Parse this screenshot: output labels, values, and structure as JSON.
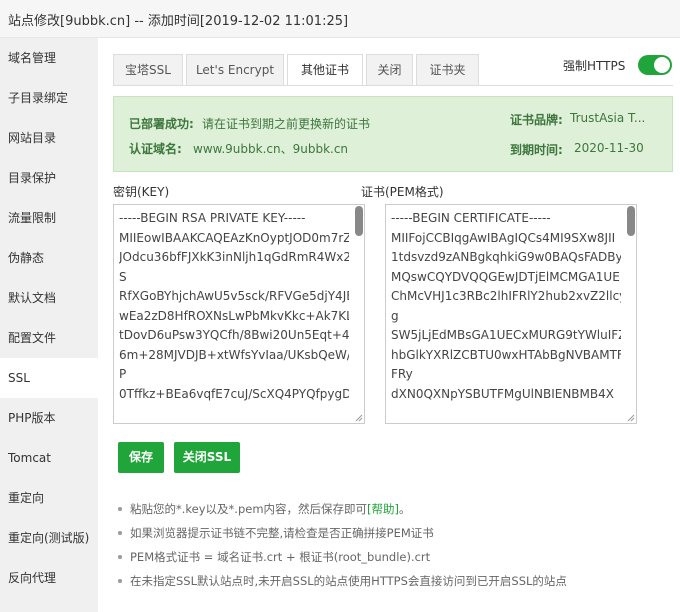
{
  "window": {
    "title": "站点修改[9ubbk.cn] -- 添加时间[2019-12-02 11:01:25]"
  },
  "sidebar": {
    "items": [
      {
        "label": "域名管理"
      },
      {
        "label": "子目录绑定"
      },
      {
        "label": "网站目录"
      },
      {
        "label": "目录保护"
      },
      {
        "label": "流量限制"
      },
      {
        "label": "伪静态"
      },
      {
        "label": "默认文档"
      },
      {
        "label": "配置文件"
      },
      {
        "label": "SSL"
      },
      {
        "label": "PHP版本"
      },
      {
        "label": "Tomcat"
      },
      {
        "label": "重定向"
      },
      {
        "label": "重定向(测试版)"
      },
      {
        "label": "反向代理"
      }
    ],
    "active": "SSL"
  },
  "tabs": [
    {
      "label": "宝塔SSL"
    },
    {
      "label": "Let's Encrypt"
    },
    {
      "label": "其他证书"
    },
    {
      "label": "关闭"
    },
    {
      "label": "证书夹"
    }
  ],
  "active_tab": "其他证书",
  "force_https": {
    "label": "强制HTTPS",
    "enabled": true
  },
  "status": {
    "deployed_key": "已部署成功:",
    "deployed_value": "请在证书到期之前更换新的证书",
    "domain_key": "认证域名:",
    "domain_value": "www.9ubbk.cn、9ubbk.cn",
    "brand_key": "证书品牌:",
    "brand_value": "TrustAsia T...",
    "expire_key": "到期时间:",
    "expire_value": "2020-11-30"
  },
  "key_field": {
    "label": "密钥(KEY)",
    "value": "-----BEGIN RSA PRIVATE KEY-----\nMIIEowIBAAKCAQEAzKnOyptJOD0m7rZ\nJOdcu36bfFJXkK3inNljh1qGdRmR4Wx2\nS\nRfXGoBYhjchAwU5v5sck/RFVGe5djY4JE\nwEa2zD8HfROXNsLwPbMkvKkc+Ak7KLJ\ntDovD6uPsw3YQCfh/8Bwi20Un5Eqt+4g\n6m+28MJVDJB+xtWfsYvIaa/UKsbQeW/\nP\n0Tffkz+BEa6vqfE7cuJ/ScXQ4PYQfpygDs"
  },
  "cert_field": {
    "label": "证书(PEM格式)",
    "value": "-----BEGIN CERTIFICATE-----\nMIIFojCCBIqgAwIBAgIQCs4MI9SXw8JII\n1tdsvzd9zANBgkqhkiG9w0BAQsFADBy\nMQswCQYDVQQGEwJDTjElMCMGA1UE\nChMcVHJ1c3RBc2lhIFRlY2hub2xvZ2llcyw\ng\nSW5jLjEdMBsGA1UECxMURG9tYWluIFZ\nhbGlkYXRlZCBTU0wxHTAbBgNVBAMTF\nFRy\ndXN0QXNpYSBUTFMgUlNBIENBMB4X"
  },
  "buttons": {
    "save": "保存",
    "close_ssl": "关闭SSL"
  },
  "tips": [
    {
      "text": "粘贴您的*.key以及*.pem内容，然后保存即可",
      "help": "[帮助]",
      "tail": "。"
    },
    {
      "text": "如果浏览器提示证书链不完整,请检查是否正确拼接PEM证书"
    },
    {
      "text": "PEM格式证书 = 域名证书.crt + 根证书(root_bundle).crt"
    },
    {
      "text": "在未指定SSL默认站点时,未开启SSL的站点使用HTTPS会直接访问到已开启SSL的站点"
    }
  ],
  "colors": {
    "accent": "#20a53a",
    "status_bg": "#dff0d8",
    "status_text": "#3c763d"
  }
}
